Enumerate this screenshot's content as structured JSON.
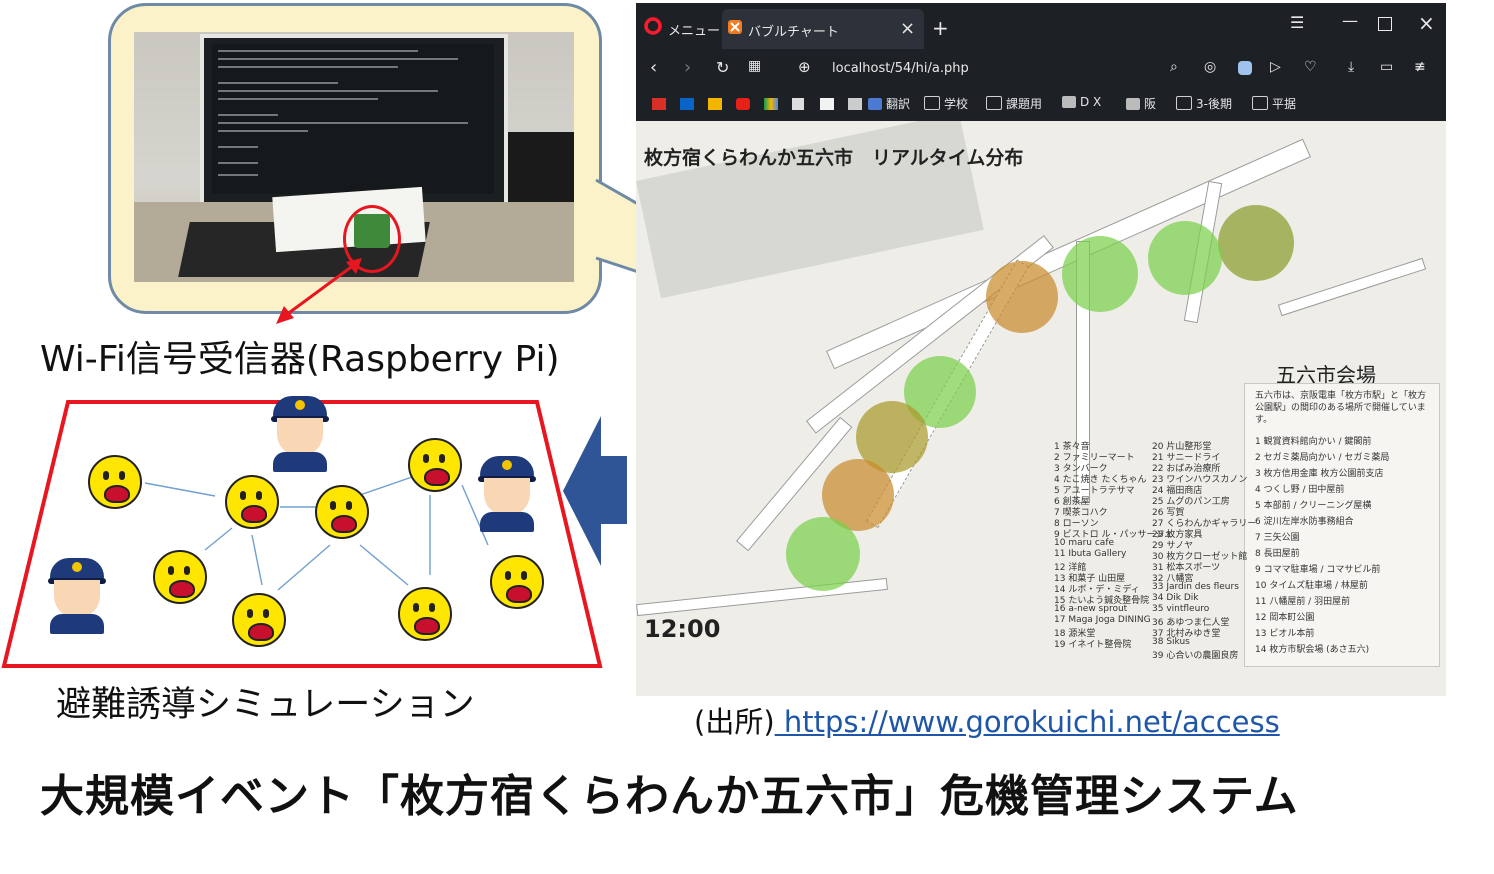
{
  "photo": {
    "caption": "Wi-Fi信号受信器(Raspberry Pi)"
  },
  "simulation": {
    "caption": "避難誘導シミュレーション"
  },
  "browser": {
    "menu_label": "メニュー",
    "tab_title": "バブルチャート",
    "new_tab_symbol": "+",
    "url": "localhost/54/hi/a.php",
    "bookmarks": [
      "翻訳",
      "学校",
      "課題用",
      "D X",
      "阪",
      "3-後期",
      "平据"
    ]
  },
  "map": {
    "title": "枚方宿くらわんか五六市　リアルタイム分布",
    "time": "12:00",
    "venue_title": "五六市会場",
    "venue_note": "五六市は、京阪電車「枚方市駅」と「枚方公園駅」の間印のある場所で開催しています。",
    "legend_left": [
      "1 茶々音",
      "2 ファミリーマート",
      "3 タンバーク",
      "4 たこ焼き たくちゃん",
      "5 アユートラテサマ",
      "6 創茶屋",
      "7 喫茶コハク",
      "8 ローソン",
      "9 ビストロ ル・パッサージュ",
      "10 maru cafe",
      "11 Ibuta Gallery",
      "12 洋館",
      "13 和菓子 山田屋",
      "14 ルボ・デ・ミディ",
      "15 たいよう鍼灸整骨院",
      "16 a-new sprout",
      "17 Maga Joga DINING",
      "18 源米堂",
      "19 イネイト整骨院"
    ],
    "legend_mid": [
      "20 片山整形堂",
      "21 サニードライ",
      "22 おばみ治療所",
      "23 ワインハウスカノン",
      "24 福田商店",
      "25 ムグのパン工房",
      "26 写賀",
      "27 くらわんかギャラリー",
      "28 枚方家具",
      "29 サノヤ",
      "30 枚方クローゼット館",
      "31 松本スポーツ",
      "32 八幡宮",
      "33 Jardin des fleurs",
      "34 Dik Dik",
      "35 vintfleuro",
      "36 あゆつま仁人堂",
      "37 北村みゆき堂",
      "38 Sikus",
      "39 心合いの農園良房"
    ],
    "legend_right": [
      "1 観賞資料館向かい / 鍵閣前",
      "2 セガミ薬局向かい / セガミ薬局",
      "3 枚方信用金庫 枚方公園前支店",
      "4 つくし野 / 田中屋前",
      "5 本部前 / クリーニング屋横",
      "6 淀川左岸水防事務組合",
      "7 三矢公園",
      "8 長田屋前",
      "9 コママ駐車場 / コマサビル前",
      "10 タイムズ駐車場 / 林屋前",
      "11 八幡屋前 / 羽田屋前",
      "12 岡本町公園",
      "13 ビオル本前",
      "14 枚方市駅会場 (あさ五六)"
    ],
    "bubbles": [
      {
        "id": 1,
        "level": "medium",
        "color": "#8a9c2c"
      },
      {
        "id": 2,
        "level": "low",
        "color": "#7bd04b"
      },
      {
        "id": 3,
        "level": "low",
        "color": "#7bd04b"
      },
      {
        "id": 4,
        "level": "high",
        "color": "#c98a2d"
      },
      {
        "id": 5,
        "level": "low",
        "color": "#7bd04b"
      },
      {
        "id": 6,
        "level": "medium",
        "color": "#a99a2a"
      },
      {
        "id": 7,
        "level": "high",
        "color": "#c98a2d"
      },
      {
        "id": 8,
        "level": "low",
        "color": "#7bd04b"
      }
    ]
  },
  "source": {
    "prefix": "(出所)",
    "url": " https://www.gorokuichi.net/access"
  },
  "main_title": "大規模イベント「枚方宿くらわんか五六市」危機管理システム",
  "colors": {
    "red": "#e8161f",
    "arrow_blue": "#2f5597",
    "link": "#1f56a8"
  }
}
